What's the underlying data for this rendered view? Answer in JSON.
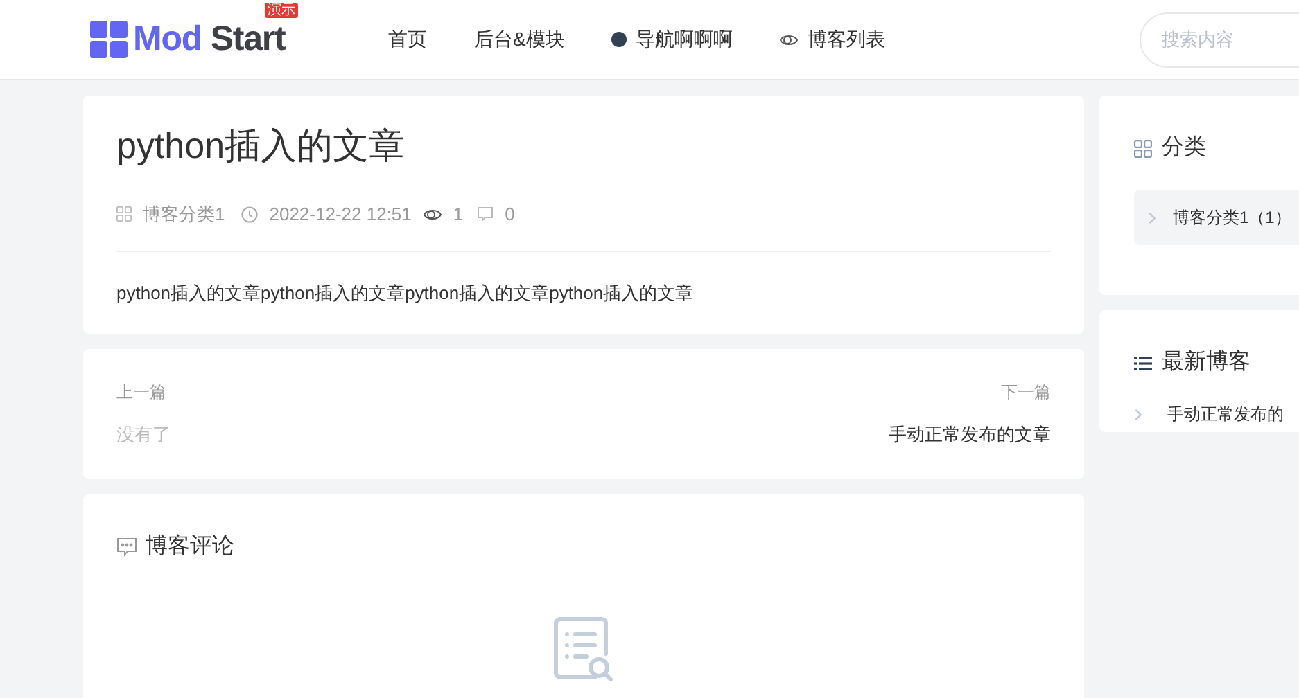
{
  "header": {
    "logo": {
      "text_left": "Mod",
      "text_right": "Start",
      "badge": "演示"
    },
    "nav": [
      {
        "label": "首页",
        "kind": "plain"
      },
      {
        "label": "后台&模块",
        "kind": "plain"
      },
      {
        "label": "导航啊啊啊",
        "kind": "dot"
      },
      {
        "label": "博客列表",
        "kind": "eye"
      }
    ],
    "search": {
      "placeholder": "搜索内容"
    }
  },
  "article": {
    "title": "python插入的文章",
    "category": "博客分类1",
    "date": "2022-12-22 12:51",
    "views": "1",
    "comments": "0",
    "body": "python插入的文章python插入的文章python插入的文章python插入的文章"
  },
  "pager": {
    "prev_label": "上一篇",
    "prev_value": "没有了",
    "next_label": "下一篇",
    "next_value": "手动正常发布的文章"
  },
  "comments": {
    "title": "博客评论"
  },
  "sidebar": {
    "categories": {
      "title": "分类",
      "items": [
        {
          "label": "博客分类1（1）"
        }
      ]
    },
    "latest": {
      "title": "最新博客",
      "items": [
        {
          "label": "手动正常发布的"
        }
      ]
    }
  }
}
